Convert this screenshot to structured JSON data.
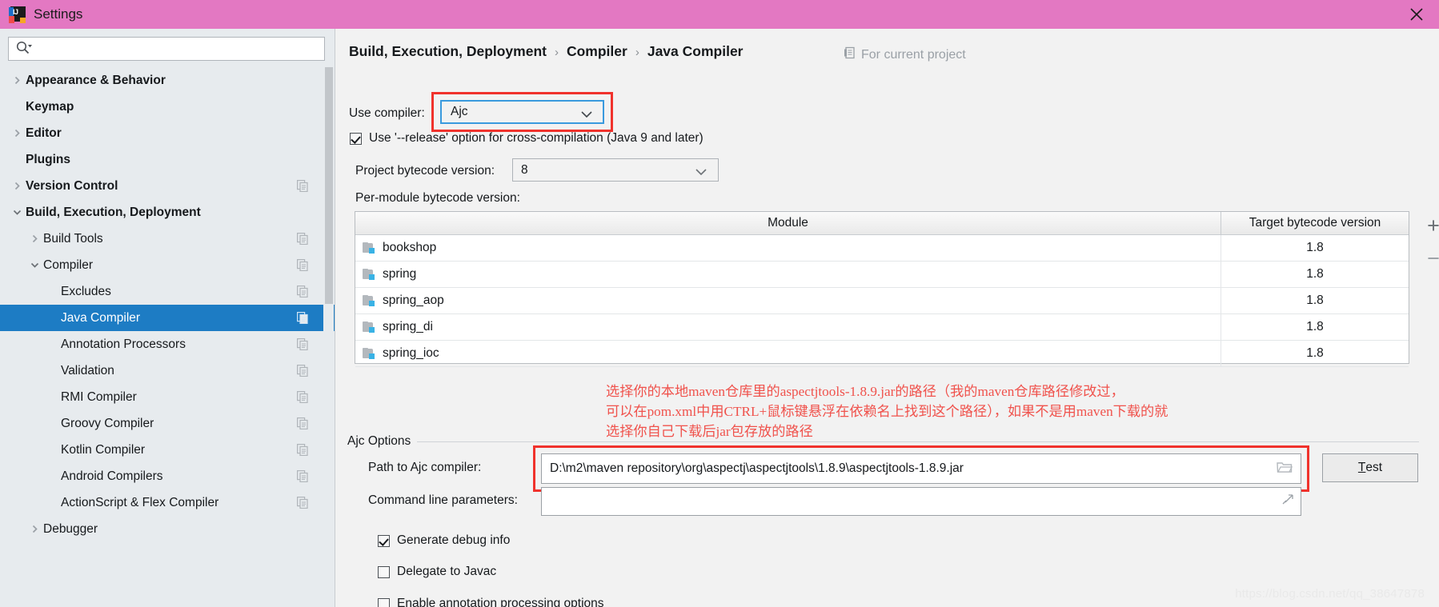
{
  "window": {
    "title": "Settings",
    "logo_text": "IJ",
    "close_label": "×",
    "titlebar_color": "#e378c2",
    "accent_color": "#1d7cc4",
    "annotation_color": "#f0322c"
  },
  "search": {
    "value": "",
    "placeholder": ""
  },
  "sidebar": {
    "items": [
      {
        "label": "Appearance & Behavior",
        "level": 0,
        "arrow": "right",
        "copy": false,
        "selected": false
      },
      {
        "label": "Keymap",
        "level": 0,
        "arrow": "none",
        "copy": false,
        "selected": false
      },
      {
        "label": "Editor",
        "level": 0,
        "arrow": "right",
        "copy": false,
        "selected": false
      },
      {
        "label": "Plugins",
        "level": 0,
        "arrow": "none",
        "copy": false,
        "selected": false
      },
      {
        "label": "Version Control",
        "level": 0,
        "arrow": "right",
        "copy": true,
        "selected": false
      },
      {
        "label": "Build, Execution, Deployment",
        "level": 0,
        "arrow": "down",
        "copy": false,
        "selected": false
      },
      {
        "label": "Build Tools",
        "level": 1,
        "arrow": "right",
        "copy": true,
        "selected": false
      },
      {
        "label": "Compiler",
        "level": 1,
        "arrow": "down",
        "copy": true,
        "selected": false
      },
      {
        "label": "Excludes",
        "level": 2,
        "arrow": "none",
        "copy": true,
        "selected": false
      },
      {
        "label": "Java Compiler",
        "level": 2,
        "arrow": "none",
        "copy": true,
        "selected": true
      },
      {
        "label": "Annotation Processors",
        "level": 2,
        "arrow": "none",
        "copy": true,
        "selected": false
      },
      {
        "label": "Validation",
        "level": 2,
        "arrow": "none",
        "copy": true,
        "selected": false
      },
      {
        "label": "RMI Compiler",
        "level": 2,
        "arrow": "none",
        "copy": true,
        "selected": false
      },
      {
        "label": "Groovy Compiler",
        "level": 2,
        "arrow": "none",
        "copy": true,
        "selected": false
      },
      {
        "label": "Kotlin Compiler",
        "level": 2,
        "arrow": "none",
        "copy": true,
        "selected": false
      },
      {
        "label": "Android Compilers",
        "level": 2,
        "arrow": "none",
        "copy": true,
        "selected": false
      },
      {
        "label": "ActionScript & Flex Compiler",
        "level": 2,
        "arrow": "none",
        "copy": true,
        "selected": false
      },
      {
        "label": "Debugger",
        "level": 1,
        "arrow": "right",
        "copy": false,
        "selected": false
      }
    ]
  },
  "main": {
    "breadcrumb": [
      "Build, Execution, Deployment",
      "Compiler",
      "Java Compiler"
    ],
    "breadcrumb_separator": "›",
    "for_current_project": "For current project",
    "use_compiler_label": "Use compiler:",
    "use_compiler_value": "Ajc",
    "release_option_label": "Use '--release' option for cross-compilation (Java 9 and later)",
    "release_option_checked": true,
    "project_bytecode_label": "Project bytecode version:",
    "project_bytecode_value": "8",
    "per_module_label": "Per-module bytecode version:",
    "table": {
      "columns": [
        "Module",
        "Target bytecode version"
      ],
      "rows": [
        {
          "module": "bookshop",
          "target": "1.8"
        },
        {
          "module": "spring",
          "target": "1.8"
        },
        {
          "module": "spring_aop",
          "target": "1.8"
        },
        {
          "module": "spring_di",
          "target": "1.8"
        },
        {
          "module": "spring_ioc",
          "target": "1.8"
        }
      ],
      "add_label": "+",
      "remove_label": "−"
    },
    "annotation_text": "选择你的本地maven仓库里的aspectjtools-1.8.9.jar的路径（我的maven仓库路径修改过，\n可以在pom.xml中用CTRL+鼠标键悬浮在依赖名上找到这个路径），如果不是用maven下载的就\n选择你自己下载后jar包存放的路径",
    "ajc_group_title": "Ajc Options",
    "path_label": "Path to Ajc compiler:",
    "path_value": "D:\\m2\\maven repository\\org\\aspectj\\aspectjtools\\1.8.9\\aspectjtools-1.8.9.jar",
    "test_button_accel": "T",
    "test_button_rest": "est",
    "cmd_label": "Command line parameters:",
    "cmd_value": "",
    "checkboxes": [
      {
        "label": "Generate debug info",
        "checked": true
      },
      {
        "label": "Delegate to Javac",
        "checked": false
      },
      {
        "label": "Enable annotation processing options",
        "checked": false
      }
    ]
  },
  "watermark": "https://blog.csdn.net/qq_38647878"
}
